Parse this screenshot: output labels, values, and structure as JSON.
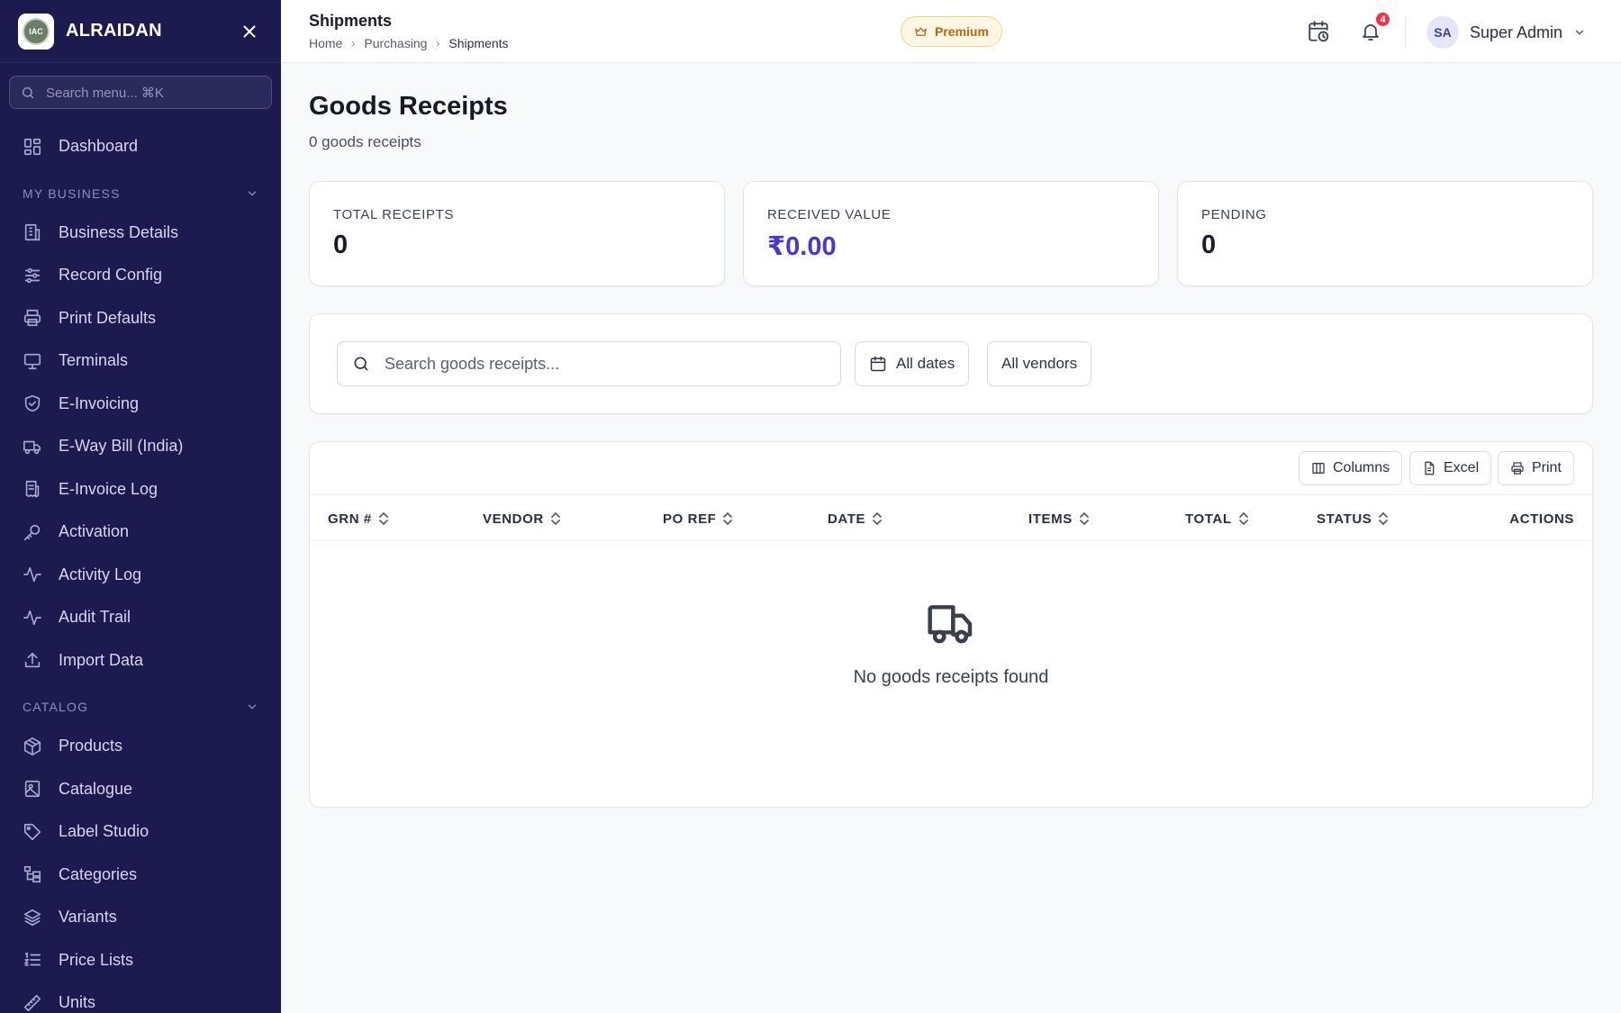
{
  "sidebar": {
    "brand": {
      "name": "ALRAIDAN",
      "logo_text": "IAC"
    },
    "search_placeholder": "Search menu... ⌘K",
    "top_items": [
      {
        "label": "Dashboard",
        "icon": "dashboard-icon"
      }
    ],
    "sections": [
      {
        "title": "MY BUSINESS",
        "items": [
          {
            "label": "Business Details",
            "icon": "building-icon"
          },
          {
            "label": "Record Config",
            "icon": "sliders-icon"
          },
          {
            "label": "Print Defaults",
            "icon": "printer-icon"
          },
          {
            "label": "Terminals",
            "icon": "monitor-icon"
          },
          {
            "label": "E-Invoicing",
            "icon": "shield-check-icon"
          },
          {
            "label": "E-Way Bill (India)",
            "icon": "truck-icon"
          },
          {
            "label": "E-Invoice Log",
            "icon": "receipt-icon"
          },
          {
            "label": "Activation",
            "icon": "key-icon"
          },
          {
            "label": "Activity Log",
            "icon": "activity-icon"
          },
          {
            "label": "Audit Trail",
            "icon": "activity-icon"
          },
          {
            "label": "Import Data",
            "icon": "upload-icon"
          }
        ]
      },
      {
        "title": "CATALOG",
        "items": [
          {
            "label": "Products",
            "icon": "box-icon"
          },
          {
            "label": "Catalogue",
            "icon": "image-book-icon"
          },
          {
            "label": "Label Studio",
            "icon": "tag-icon"
          },
          {
            "label": "Categories",
            "icon": "hierarchy-icon"
          },
          {
            "label": "Variants",
            "icon": "layers-icon"
          },
          {
            "label": "Price Lists",
            "icon": "list-ordered-icon"
          },
          {
            "label": "Units",
            "icon": "ruler-icon"
          }
        ]
      }
    ]
  },
  "header": {
    "title": "Shipments",
    "breadcrumb": [
      "Home",
      "Purchasing",
      "Shipments"
    ],
    "premium_label": "Premium",
    "notification_count": "4",
    "user": {
      "initials": "SA",
      "name": "Super Admin"
    }
  },
  "page": {
    "title": "Goods Receipts",
    "subtitle": "0 goods receipts",
    "stats": [
      {
        "label": "TOTAL RECEIPTS",
        "value": "0"
      },
      {
        "label": "RECEIVED VALUE",
        "value": "₹0.00"
      },
      {
        "label": "PENDING",
        "value": "0"
      }
    ],
    "filters": {
      "search_placeholder": "Search goods receipts...",
      "date_label": "All dates",
      "vendor_label": "All vendors"
    },
    "toolbar": {
      "columns_label": "Columns",
      "excel_label": "Excel",
      "print_label": "Print"
    },
    "table": {
      "columns": [
        "GRN #",
        "VENDOR",
        "PO REF",
        "DATE",
        "ITEMS",
        "TOTAL",
        "STATUS",
        "ACTIONS"
      ],
      "rows": [],
      "empty_message": "No goods receipts found"
    }
  },
  "colors": {
    "sidebar_bg": "#1d1a4f",
    "accent": "#4a36d1",
    "badge": "#ef3340",
    "premium": "#b8650a"
  }
}
